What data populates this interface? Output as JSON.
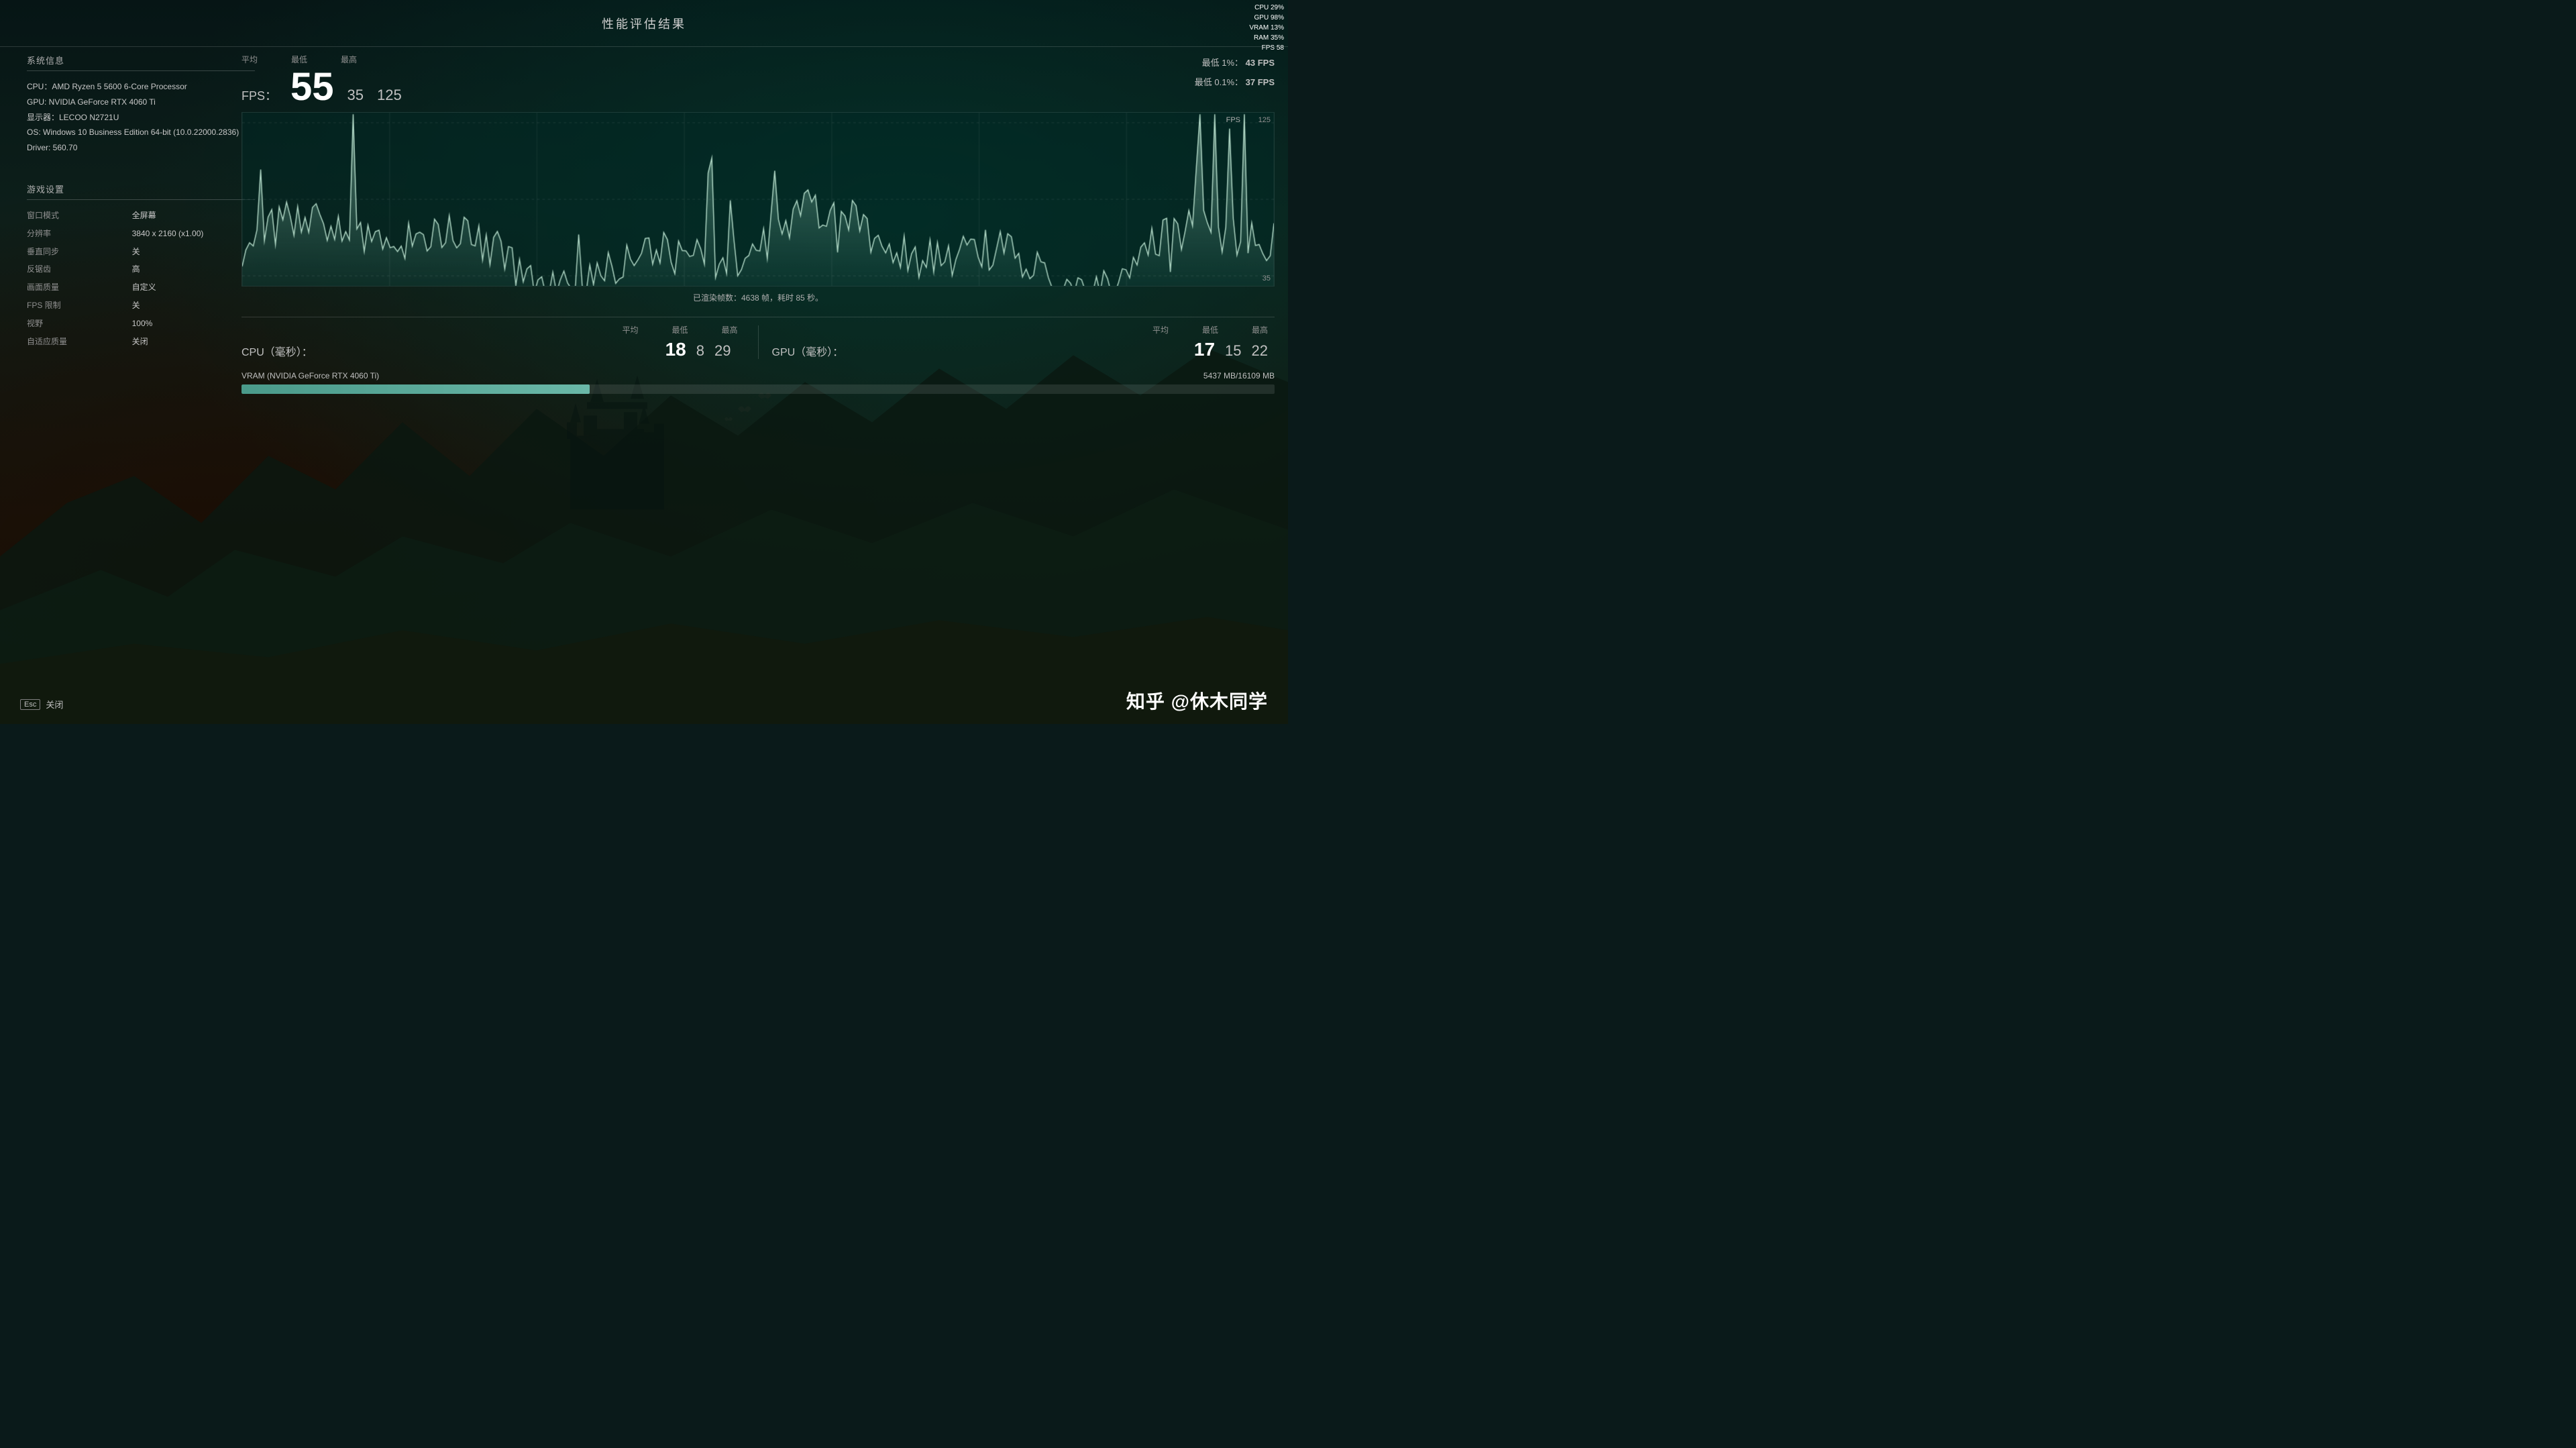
{
  "title": "性能评估结果",
  "hud": {
    "cpu": "CPU 29%",
    "gpu": "GPU 98%",
    "vram": "VRAM 13%",
    "ram": "RAM 35%",
    "fps": "FPS  58"
  },
  "system": {
    "section_title": "系统信息",
    "cpu": "CPU：AMD Ryzen 5 5600 6-Core Processor",
    "gpu": "GPU: NVIDIA GeForce RTX 4060 Ti",
    "monitor": "显示器：LECOO N2721U",
    "os": "OS: Windows 10 Business Edition 64-bit (10.0.22000.2836)",
    "driver": "Driver: 560.70"
  },
  "settings": {
    "section_title": "游戏设置",
    "items": [
      {
        "label": "窗口模式",
        "value": "全屏幕"
      },
      {
        "label": "分辨率",
        "value": "3840 x 2160 (x1.00)"
      },
      {
        "label": "垂直同步",
        "value": "关"
      },
      {
        "label": "反锯齿",
        "value": "高"
      },
      {
        "label": "画面质量",
        "value": "自定义"
      },
      {
        "label": "FPS 限制",
        "value": "关"
      },
      {
        "label": "视野",
        "value": "100%"
      },
      {
        "label": "自适应质量",
        "value": "关闭"
      }
    ]
  },
  "fps": {
    "label": "FPS：",
    "avg_label": "平均",
    "min_label": "最低",
    "max_label": "最高",
    "avg": "55",
    "min": "35",
    "max": "125",
    "p1_label": "最低 1%：",
    "p1_value": "43 FPS",
    "p01_label": "最低 0.1%：",
    "p01_value": "37 FPS",
    "graph_fps_label": "FPS",
    "graph_max": "125",
    "graph_min": "35"
  },
  "rendered_frames": "已渲染帧数：4638 帧，耗时 85 秒。",
  "cpu_ms": {
    "label": "CPU（毫秒）：",
    "avg_header": "平均",
    "min_header": "最低",
    "max_header": "最高",
    "avg": "18",
    "min": "8",
    "max": "29"
  },
  "gpu_ms": {
    "label": "GPU（毫秒）：",
    "avg_header": "平均",
    "min_header": "最低",
    "max_header": "最高",
    "avg": "17",
    "min": "15",
    "max": "22"
  },
  "vram": {
    "label": "VRAM (NVIDIA GeForce RTX 4060 Ti)",
    "value": "5437 MB/16109 MB",
    "fill_pct": 33.7
  },
  "close": {
    "esc": "Esc",
    "label": "关闭"
  },
  "watermark": "知乎 @休木同学"
}
